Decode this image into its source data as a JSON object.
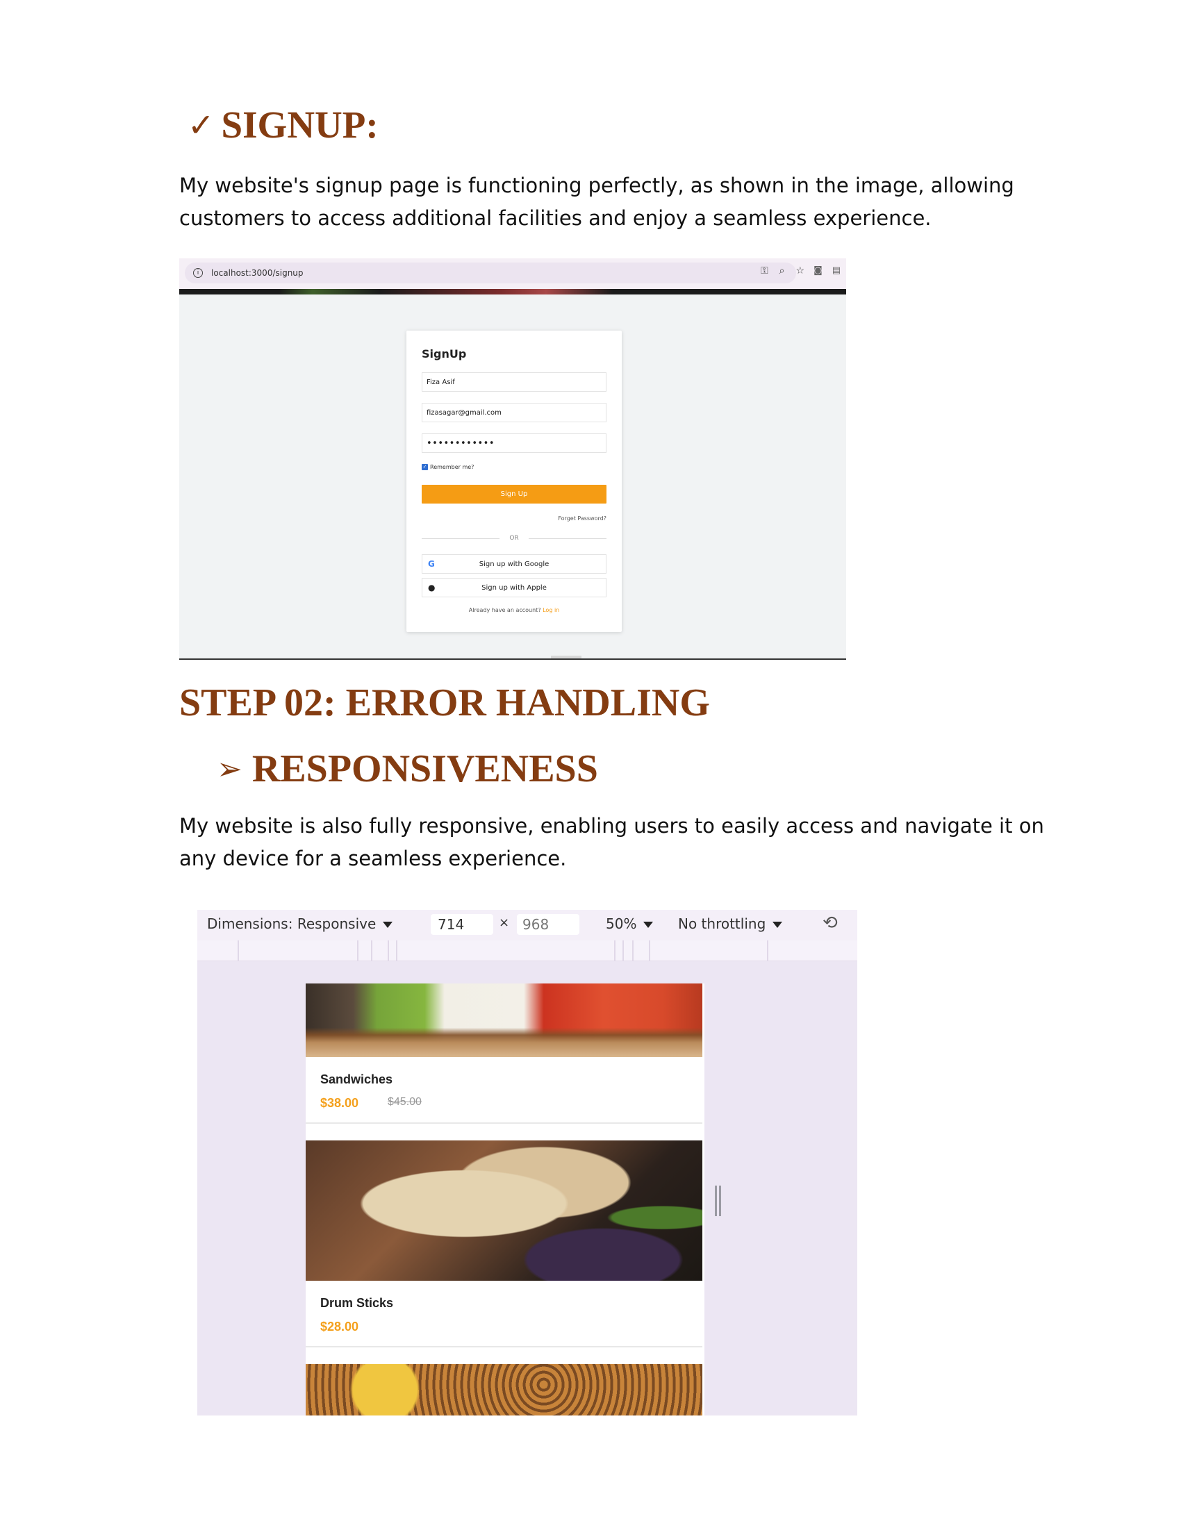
{
  "section1": {
    "check_glyph": "✓",
    "title": "SIGNUP:",
    "paragraph": "My website's signup page is functioning perfectly, as shown in the image, allowing customers to access additional facilities and enjoy a seamless experience."
  },
  "browser": {
    "url": "localhost:3000/signup",
    "info_glyph": "i",
    "icons": [
      "key-icon",
      "zoom-icon",
      "star-icon",
      "camera-icon",
      "extension-icon"
    ]
  },
  "signup_form": {
    "title": "SignUp",
    "name_value": "Fiza Asif",
    "email_value": "fizasagar@gmail.com",
    "password_value": "••••••••••••",
    "remember_label": "Remember me?",
    "submit_label": "Sign Up",
    "forgot_label": "Forget Password?",
    "divider_label": "OR",
    "google_label": "Sign up with Google",
    "apple_label": "Sign up with Apple",
    "already_text": "Already have an account?",
    "login_link": "Log in"
  },
  "section2": {
    "title": "STEP 02: ERROR HANDLING",
    "sub_glyph": "➢",
    "subtitle": "RESPONSIVENESS",
    "paragraph": "My website is also fully responsive, enabling users to easily access and navigate it on any device for a seamless experience."
  },
  "devtools": {
    "dimensions_label": "Dimensions: Responsive",
    "width_value": "714",
    "times": "×",
    "height_value": "968",
    "zoom_label": "50%",
    "throttle_label": "No throttling"
  },
  "menu_items": [
    {
      "name": "Sandwiches",
      "price": "$38.00",
      "old_price": "$45.00"
    },
    {
      "name": "Drum Sticks",
      "price": "$28.00"
    }
  ],
  "colors": {
    "heading": "#843c11",
    "accent": "#f59c14"
  }
}
